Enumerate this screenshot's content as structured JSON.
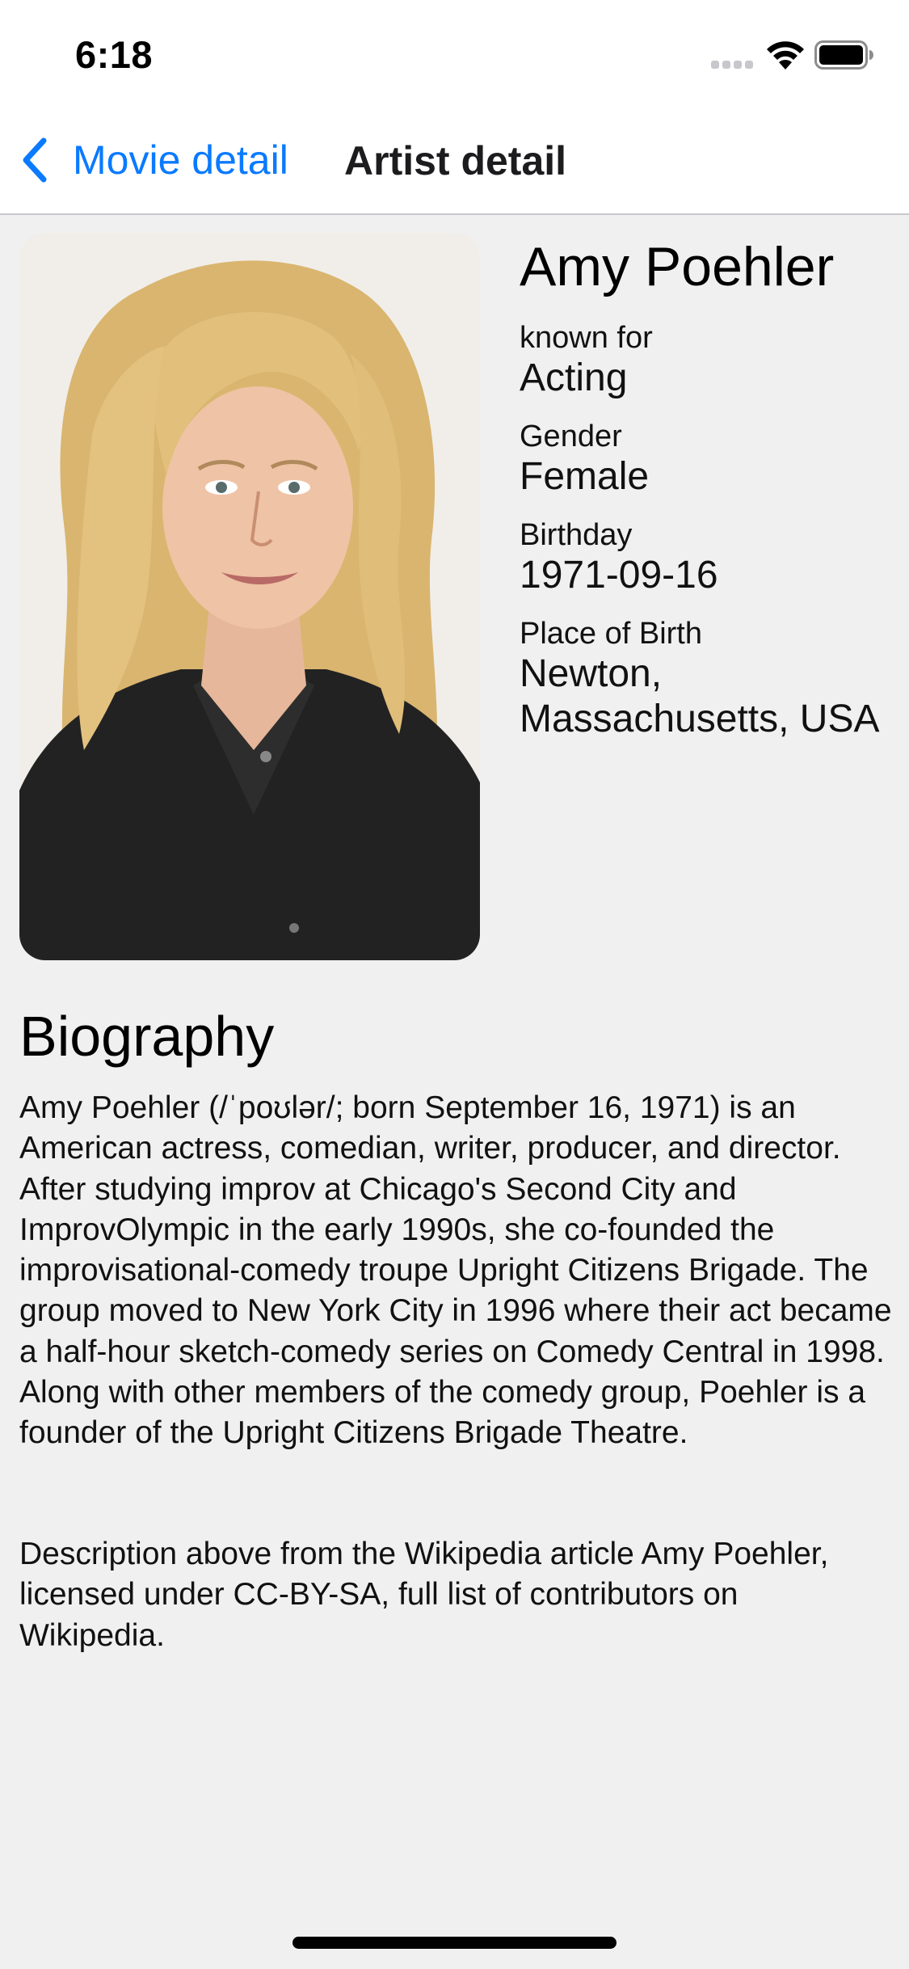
{
  "status_bar": {
    "time": "6:18",
    "icons": [
      "signal-icon",
      "wifi-icon",
      "battery-icon"
    ]
  },
  "nav": {
    "back_label": "Movie detail",
    "back_icon": "chevron-left-icon",
    "title": "Artist detail",
    "accent_color": "#0a7aff"
  },
  "artist": {
    "name": "Amy Poehler",
    "photo": "artist-portrait",
    "fields": [
      {
        "label": "known for",
        "value": "Acting"
      },
      {
        "label": "Gender",
        "value": "Female"
      },
      {
        "label": "Birthday",
        "value": "1971-09-16"
      },
      {
        "label": "Place of Birth",
        "value": "Newton, Massachusetts, USA"
      }
    ]
  },
  "biography": {
    "heading": "Biography",
    "text": "Amy Poehler (/ˈpoʊlər/; born September 16, 1971) is an American actress, comedian, writer, producer, and director. After studying improv at Chicago's Second City and ImprovOlympic in the early 1990s, she co-founded the improvisational-comedy troupe Upright Citizens Brigade. The group moved to New York City in 1996 where their act became a half-hour sketch-comedy series on Comedy Central in 1998. Along with other members of the comedy group, Poehler is a founder of the Upright Citizens Brigade Theatre.",
    "attribution": "Description above from the Wikipedia article Amy Poehler, licensed under CC-BY-SA, full list of contributors on Wikipedia."
  }
}
